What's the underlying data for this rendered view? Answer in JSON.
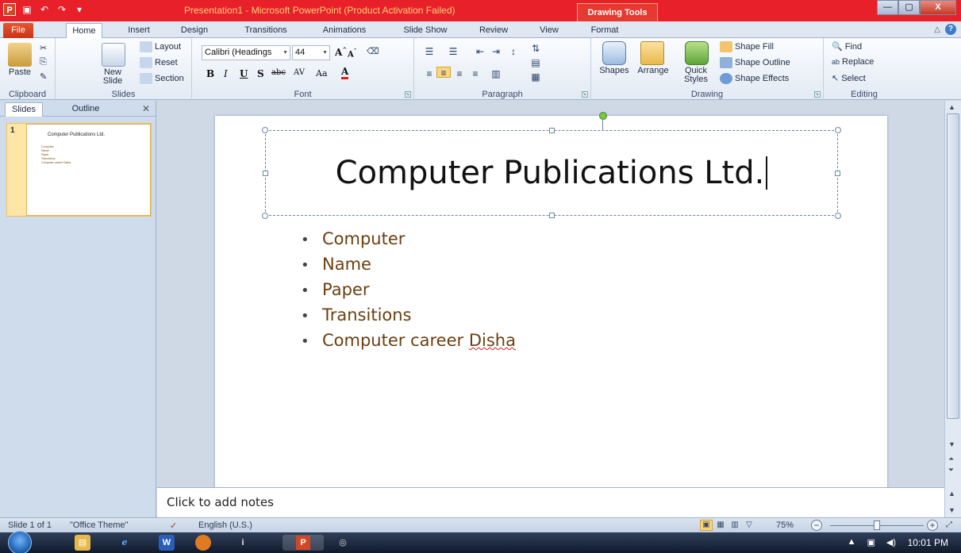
{
  "window": {
    "title": "Presentation1  -  Microsoft PowerPoint (Product Activation Failed)",
    "context_tab": "Drawing Tools",
    "minimize": "—",
    "maximize": "▢",
    "close": "X"
  },
  "tabs": [
    "File",
    "Home",
    "Insert",
    "Design",
    "Transitions",
    "Animations",
    "Slide Show",
    "Review",
    "View",
    "Format"
  ],
  "ribbon": {
    "clipboard": {
      "label": "Clipboard",
      "paste": "Paste"
    },
    "slides": {
      "label": "Slides",
      "new_slide_1": "New",
      "new_slide_2": "Slide",
      "layout": "Layout",
      "reset": "Reset",
      "section": "Section"
    },
    "font": {
      "label": "Font",
      "family": "Calibri (Headings",
      "size": "44"
    },
    "paragraph": {
      "label": "Paragraph"
    },
    "drawing": {
      "label": "Drawing",
      "shapes": "Shapes",
      "arrange": "Arrange",
      "quick_styles_1": "Quick",
      "quick_styles_2": "Styles",
      "shape_fill": "Shape Fill",
      "shape_outline": "Shape Outline",
      "shape_effects": "Shape Effects"
    },
    "editing": {
      "label": "Editing",
      "find": "Find",
      "replace": "Replace",
      "select": "Select"
    }
  },
  "left_pane": {
    "tab_slides": "Slides",
    "tab_outline": "Outline",
    "thumb_number": "1"
  },
  "slide": {
    "title": "Computer Publications Ltd.",
    "bullets": [
      "Computer",
      "Name",
      "Paper",
      "Transitions"
    ],
    "last_bullet_prefix": "Computer career ",
    "last_bullet_misspelled": "Disha"
  },
  "notes": {
    "placeholder": "Click to add notes"
  },
  "status": {
    "slide": "Slide 1 of 1",
    "theme": "\"Office Theme\"",
    "language": "English (U.S.)",
    "zoom": "75%",
    "zoom_level": 0.5
  },
  "taskbar": {
    "clock": "10:01 PM"
  },
  "colors": {
    "title_bar": "#e8202a",
    "bullet_text": "#6b3f10",
    "accent": "#d24726"
  }
}
